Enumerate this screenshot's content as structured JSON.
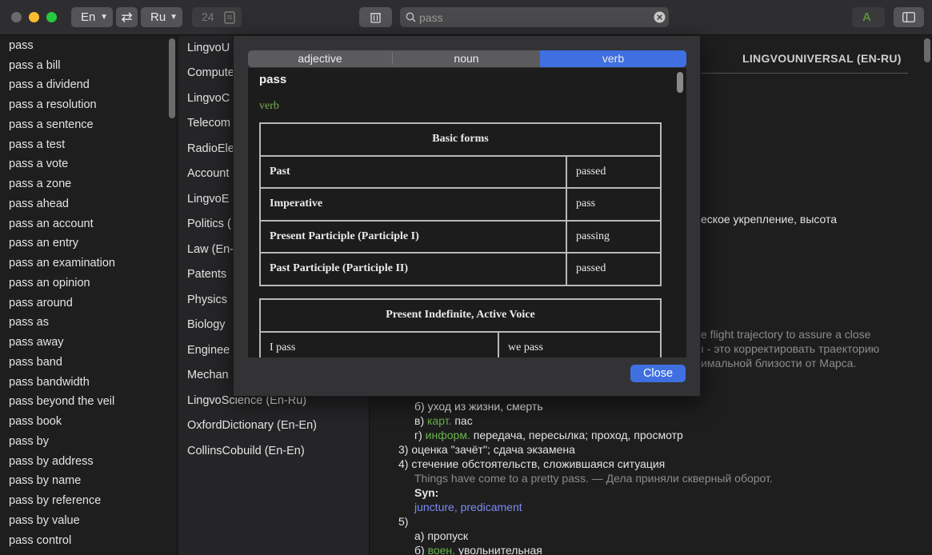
{
  "toolbar": {
    "source_lang": "En",
    "target_lang": "Ru",
    "font_size": "24",
    "search_value": "pass",
    "search_placeholder": "pass"
  },
  "word_list": [
    "pass",
    "pass a bill",
    "pass a dividend",
    "pass a resolution",
    "pass a sentence",
    "pass a test",
    "pass a vote",
    "pass a zone",
    "pass ahead",
    "pass an account",
    "pass an entry",
    "pass an examination",
    "pass an opinion",
    "pass around",
    "pass as",
    "pass away",
    "pass band",
    "pass bandwidth",
    "pass beyond the veil",
    "pass book",
    "pass by",
    "pass by address",
    "pass by name",
    "pass by reference",
    "pass by value",
    "pass control"
  ],
  "dictionaries": [
    "LingvoU",
    "Compute",
    "LingvoC",
    "Telecom",
    "RadioEle",
    "Account",
    "LingvoE",
    "Politics (",
    "Law (En-",
    "Patents",
    "Physics",
    "Biology",
    "Enginee",
    "Mechan",
    "LingvoScience (En-Ru)",
    "OxfordDictionary (En-En)",
    "CollinsCobuild (En-En)"
  ],
  "article": {
    "dict_title": "LINGVOUNIVERSAL (EN-RU)",
    "frag1": "еское укрепление, высота",
    "frag2": "e flight trajectory to assure a close",
    "frag3": "ı - это корректировать траекторию",
    "frag4": "имальной близости от Марса.",
    "l1": "б) уход из жизни, смерть",
    "l2_pre": "в) ",
    "l2_label": "карт.",
    "l2_text": " пас",
    "l3_pre": "г) ",
    "l3_label": "информ.",
    "l3_text": " передача, пересылка; проход, просмотр",
    "l4": "3) оценка \"зачёт\"; сдача экзамена",
    "l5": "4) стечение обстоятельств, сложившаяся ситуация",
    "l6": "Things have come to a pretty pass. — Дела приняли скверный оборот.",
    "l7": "Syn:",
    "l8a": "juncture",
    "l8sep": ", ",
    "l8b": "predicament",
    "l9": "5)",
    "l10": "а) пропуск",
    "l11_pre": "б) ",
    "l11_label": "воен.",
    "l11_text": " увольнительная"
  },
  "modal": {
    "tabs": [
      "adjective",
      "noun",
      "verb"
    ],
    "active_tab": "verb",
    "word": "pass",
    "pos": "verb",
    "basic_forms_title": "Basic forms",
    "basic_forms": [
      {
        "label": "Past",
        "value": "passed"
      },
      {
        "label": "Imperative",
        "value": "pass"
      },
      {
        "label": "Present Participle (Participle I)",
        "value": "passing"
      },
      {
        "label": "Past Participle (Participle II)",
        "value": "passed"
      }
    ],
    "present_title": "Present Indefinite, Active Voice",
    "present_row": [
      "I pass",
      "we pass"
    ],
    "close_label": "Close"
  },
  "colors": {
    "accent": "#3f6fe0",
    "label_green": "#6bb34c",
    "link_blue": "#7c8cf5",
    "close_red": "#ff5f57",
    "minimize_yellow": "#febc2e",
    "zoom_green": "#28c840"
  }
}
